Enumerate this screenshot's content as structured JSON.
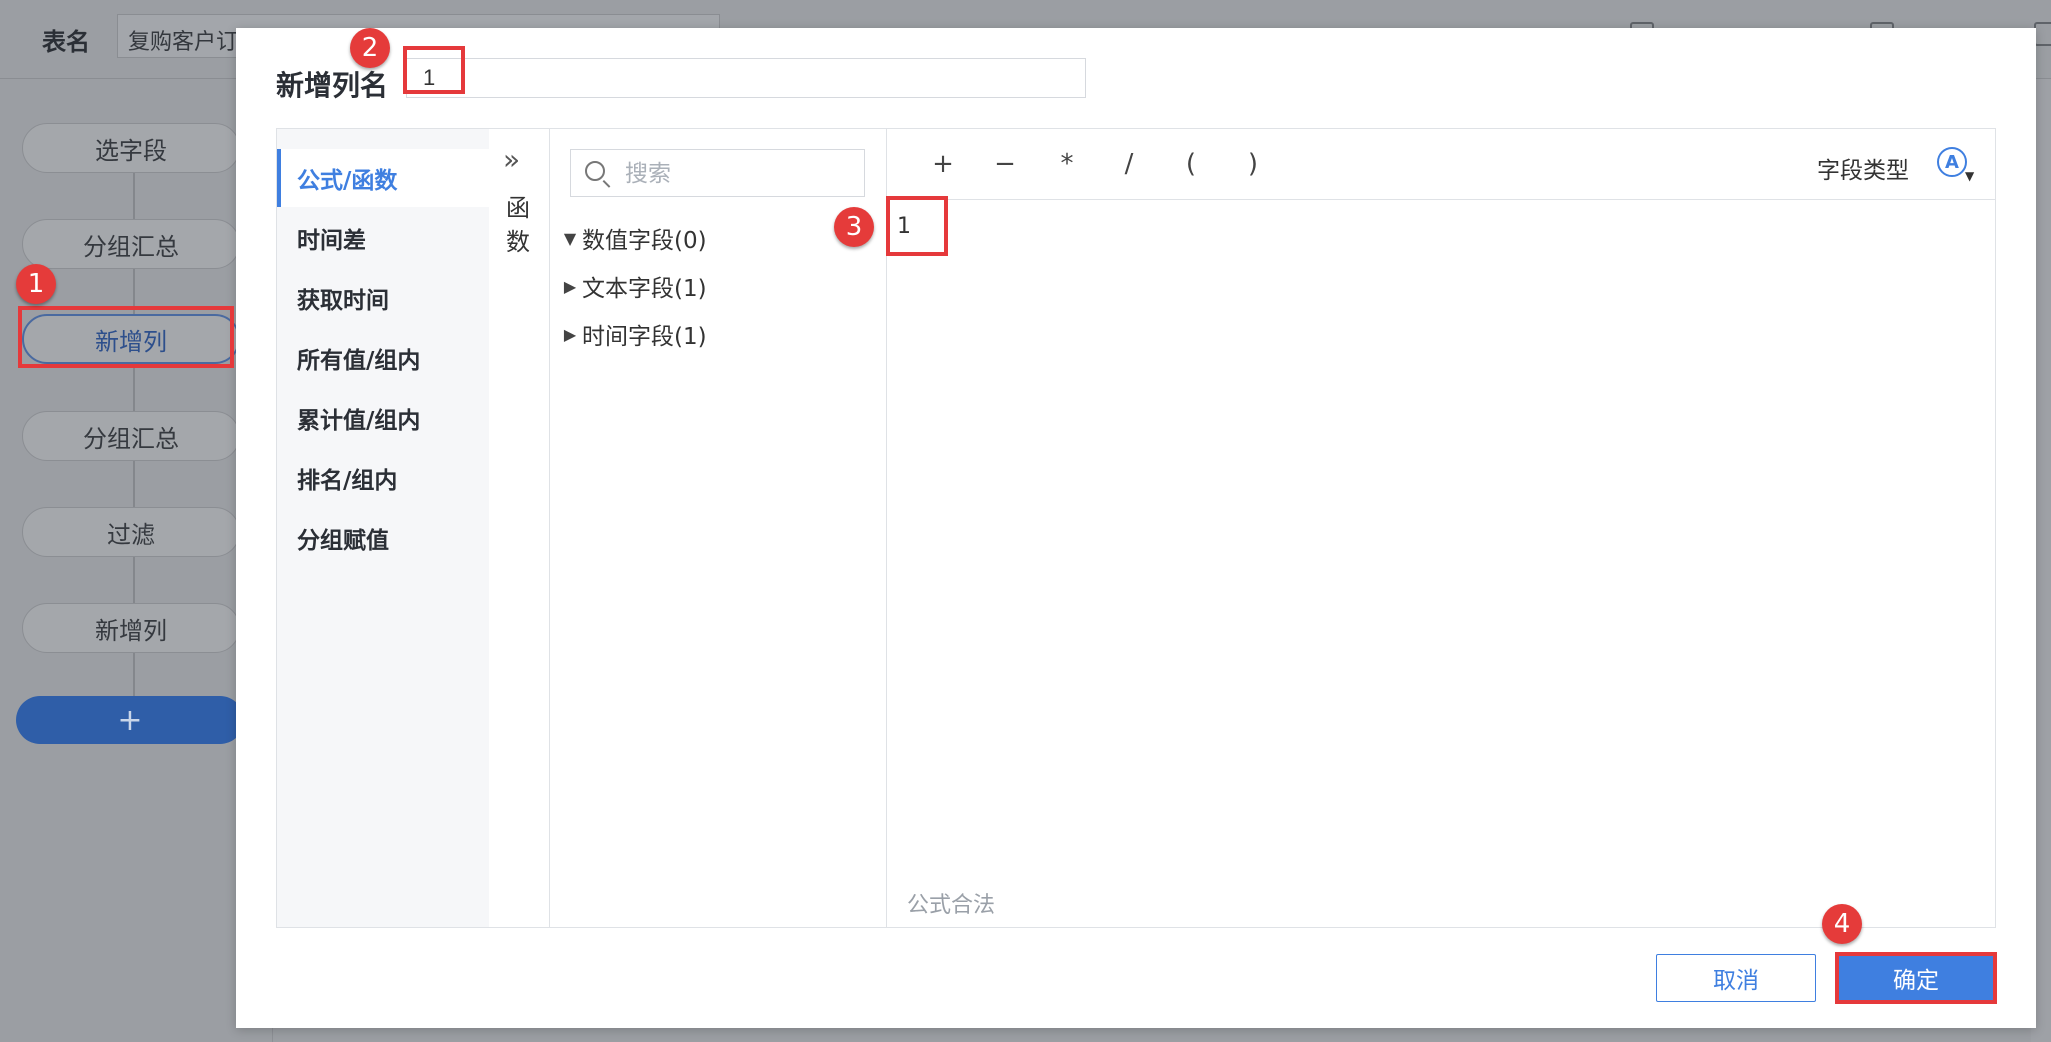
{
  "background": {
    "table_name_label": "表名",
    "table_name_value": "复购客户订",
    "steps": [
      "选字段",
      "分组汇总",
      "新增列",
      "分组汇总",
      "过滤",
      "新增列"
    ],
    "active_step_index": 2,
    "add_step_label": "+"
  },
  "dialog": {
    "title": "新增列名",
    "column_name": "1",
    "categories": [
      "公式/函数",
      "时间差",
      "获取时间",
      "所有值/组内",
      "累计值/组内",
      "排名/组内",
      "分组赋值"
    ],
    "active_category_index": 0,
    "func_tab": {
      "chevron": "»",
      "label": "函数"
    },
    "search": {
      "placeholder": "搜索"
    },
    "field_groups": [
      {
        "arrow": "▼",
        "label": "数值字段(0)"
      },
      {
        "arrow": "▶",
        "label": "文本字段(1)"
      },
      {
        "arrow": "▶",
        "label": "时间字段(1)"
      }
    ],
    "operators": [
      "+",
      "−",
      "*",
      "/",
      "(",
      ")"
    ],
    "field_type_label": "字段类型",
    "field_type_icon": "Ⓐ",
    "formula": "1",
    "formula_status": "公式合法",
    "cancel_label": "取消",
    "ok_label": "确定"
  },
  "annotations": [
    "1",
    "2",
    "3",
    "4"
  ],
  "colors": {
    "accent": "#3f7fe0",
    "annotation": "#e5393b",
    "overlay": "#9b9ea3"
  }
}
